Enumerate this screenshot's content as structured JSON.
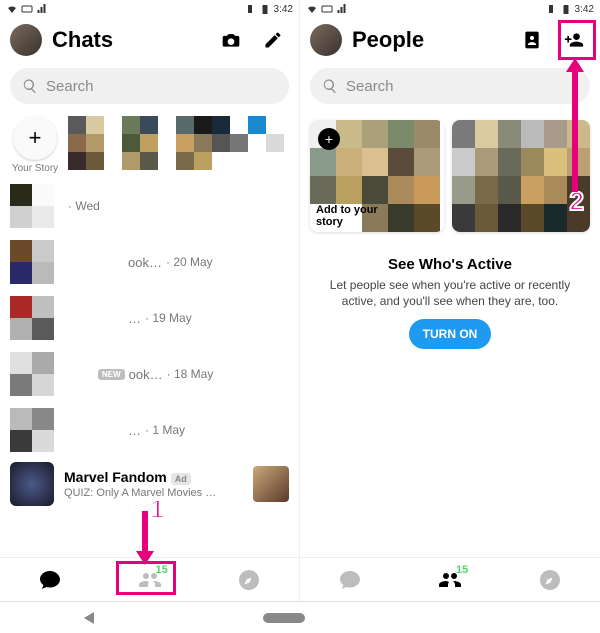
{
  "status": {
    "time": "3:42"
  },
  "left": {
    "title": "Chats",
    "search_placeholder": "Search",
    "your_story_label": "Your Story",
    "chats": [
      {
        "preview": "",
        "date": "Wed"
      },
      {
        "preview": "ook…",
        "date": "20 May"
      },
      {
        "preview": "…",
        "date": "19 May"
      },
      {
        "preview": "ook…",
        "date": "18 May",
        "new_badge": "NEW"
      },
      {
        "preview": "…",
        "date": "1 May"
      }
    ],
    "ad": {
      "title": "Marvel Fandom",
      "badge": "Ad",
      "subtitle": "QUIZ: Only A Marvel Movies …"
    },
    "tabs": {
      "people_count": "15"
    }
  },
  "right": {
    "title": "People",
    "search_placeholder": "Search",
    "add_story_label": "Add to your story",
    "promo": {
      "heading": "See Who's Active",
      "body": "Let people see when you're active or recently active, and you'll see when they are, too.",
      "button": "TURN ON"
    },
    "tabs": {
      "people_count": "15"
    }
  },
  "annotations": {
    "step1": "1",
    "step2": "2"
  }
}
